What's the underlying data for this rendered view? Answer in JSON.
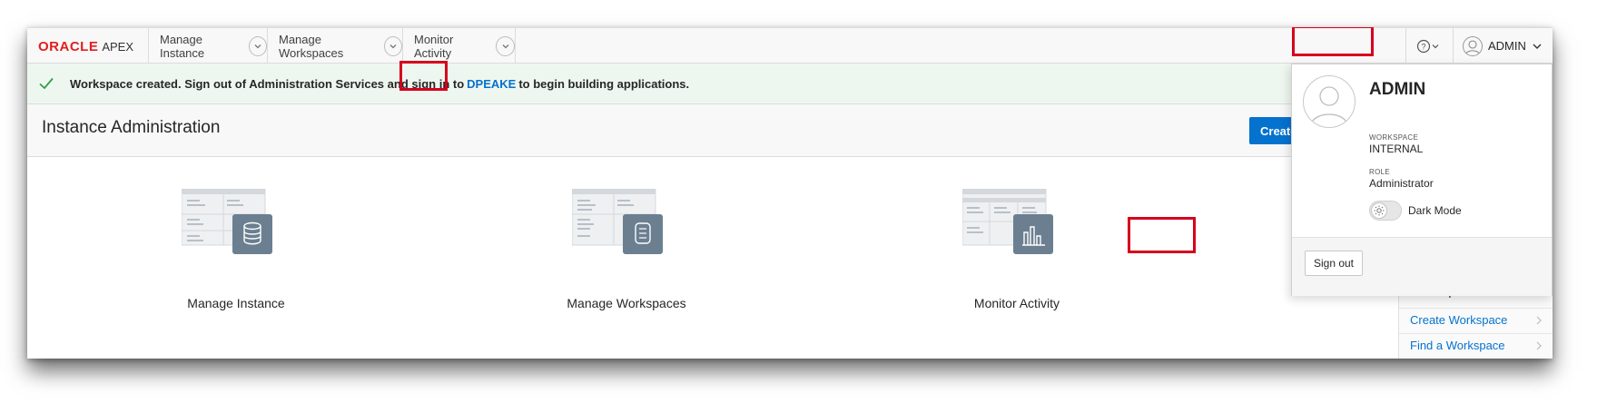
{
  "nav": {
    "logo_brand": "ORACLE",
    "logo_product": "APEX",
    "items": [
      {
        "label": "Manage Instance"
      },
      {
        "label": "Manage Workspaces"
      },
      {
        "label": "Monitor Activity"
      }
    ],
    "user_label": "ADMIN"
  },
  "alert": {
    "text_before": "Workspace created. Sign out of Administration Services and sign in to",
    "link": "DPEAKE",
    "text_after": "to begin building applications."
  },
  "page": {
    "title": "Instance Administration",
    "create_button": "Create Workspace"
  },
  "cards": [
    {
      "label": "Manage Instance",
      "icon": "database-icon"
    },
    {
      "label": "Manage Workspaces",
      "icon": "database-icon"
    },
    {
      "label": "Monitor Activity",
      "icon": "bar-chart-icon"
    }
  ],
  "side": {
    "title": "Workspace Tasks",
    "links": [
      "Create Workspace",
      "Find a Workspace"
    ]
  },
  "user_menu": {
    "name": "ADMIN",
    "workspace_label": "WORKSPACE",
    "workspace_value": "INTERNAL",
    "role_label": "ROLE",
    "role_value": "Administrator",
    "dark_mode_label": "Dark Mode",
    "sign_out": "Sign out"
  },
  "colors": {
    "accent": "#0572ce",
    "oracle_red": "#e02020",
    "highlight": "#d6001c",
    "success": "#2e9e44",
    "tile": "#6b7f91"
  }
}
